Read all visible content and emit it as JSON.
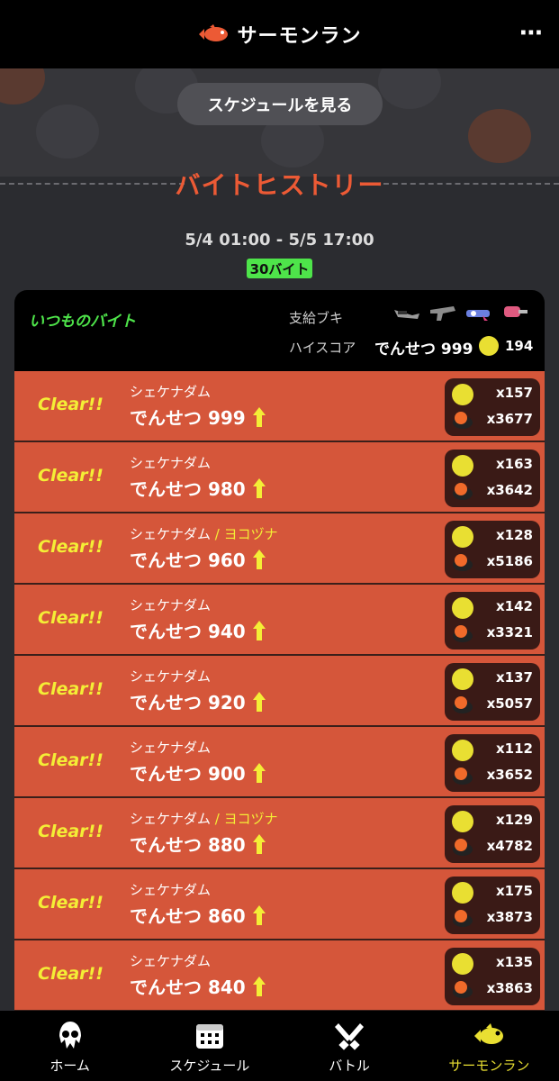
{
  "header": {
    "title": "サーモンラン",
    "more_icon": "⋯"
  },
  "schedule_button": "スケジュールを見る",
  "section_title": "バイトヒストリー",
  "period": "5/4 01:00 - 5/5 17:00",
  "job_count": "30バイト",
  "card": {
    "mode": "いつものバイト",
    "supply_label": "支給ブキ",
    "highscore_label": "ハイスコア",
    "highscore_rank": "でんせつ 999",
    "highscore_eggs": "194"
  },
  "jobs": [
    {
      "result": "Clear!!",
      "stage": "シェケナダム",
      "extra": "",
      "rank": "でんせつ 999",
      "golden": "x157",
      "power": "x3677"
    },
    {
      "result": "Clear!!",
      "stage": "シェケナダム",
      "extra": "",
      "rank": "でんせつ 980",
      "golden": "x163",
      "power": "x3642"
    },
    {
      "result": "Clear!!",
      "stage": "シェケナダム",
      "extra": " / ヨコヅナ",
      "rank": "でんせつ 960",
      "golden": "x128",
      "power": "x5186"
    },
    {
      "result": "Clear!!",
      "stage": "シェケナダム",
      "extra": "",
      "rank": "でんせつ 940",
      "golden": "x142",
      "power": "x3321"
    },
    {
      "result": "Clear!!",
      "stage": "シェケナダム",
      "extra": "",
      "rank": "でんせつ 920",
      "golden": "x137",
      "power": "x5057"
    },
    {
      "result": "Clear!!",
      "stage": "シェケナダム",
      "extra": "",
      "rank": "でんせつ 900",
      "golden": "x112",
      "power": "x3652"
    },
    {
      "result": "Clear!!",
      "stage": "シェケナダム",
      "extra": " / ヨコヅナ",
      "rank": "でんせつ 880",
      "golden": "x129",
      "power": "x4782"
    },
    {
      "result": "Clear!!",
      "stage": "シェケナダム",
      "extra": "",
      "rank": "でんせつ 860",
      "golden": "x175",
      "power": "x3873"
    },
    {
      "result": "Clear!!",
      "stage": "シェケナダム",
      "extra": "",
      "rank": "でんせつ 840",
      "golden": "x135",
      "power": "x3863"
    }
  ],
  "tabs": [
    {
      "label": "ホーム",
      "icon": "squid-icon",
      "active": false
    },
    {
      "label": "スケジュール",
      "icon": "calendar-icon",
      "active": false
    },
    {
      "label": "バトル",
      "icon": "crossed-weapons-icon",
      "active": false
    },
    {
      "label": "サーモンラン",
      "icon": "salmon-icon",
      "active": true
    }
  ],
  "colors": {
    "accent_red": "#d5563a",
    "title_orange": "#ec5a35",
    "green": "#4ee44a",
    "yellow": "#e9df32"
  }
}
